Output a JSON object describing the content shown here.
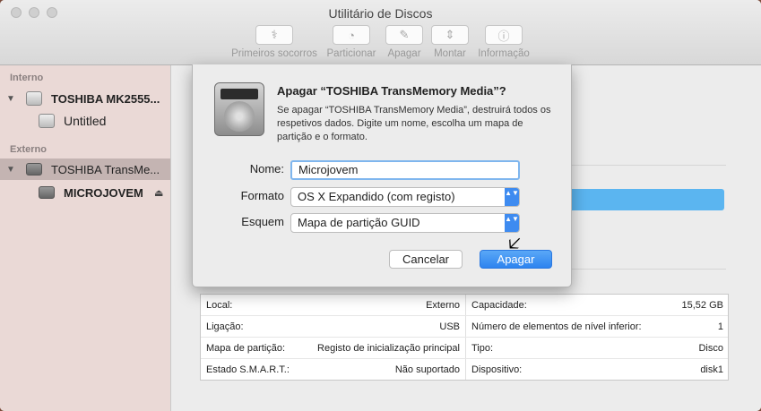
{
  "window": {
    "title": "Utilitário de Discos"
  },
  "toolbar": [
    {
      "label": "Primeiros socorros",
      "icon": "stethoscope-icon",
      "glyph": "⚕"
    },
    {
      "label": "Particionar",
      "icon": "pie-icon",
      "glyph": "◔"
    },
    {
      "label": "Apagar",
      "icon": "eraser-icon",
      "glyph": "✎"
    },
    {
      "label": "Montar",
      "icon": "mount-icon",
      "glyph": "⇕"
    },
    {
      "label": "Informação",
      "icon": "info-icon",
      "glyph": "ⓘ"
    }
  ],
  "sidebar": {
    "internal_header": "Interno",
    "external_header": "Externo",
    "internal_disk": "TOSHIBA MK2555...",
    "internal_volume": "Untitled",
    "external_disk": "TOSHIBA TransMe...",
    "external_volume": "MICROJOVEM",
    "triangle": "▼",
    "eject": "⏏"
  },
  "dialog": {
    "title": "Apagar “TOSHIBA TransMemory Media”?",
    "message": "Se apagar “TOSHIBA TransMemory Media”, destruirá todos os respetivos dados. Digite um nome, escolha um mapa de partição e o formato.",
    "name_label": "Nome:",
    "name_value": "Microjovem",
    "format_label": "Formato",
    "format_value": "OS X Expandido (com registo)",
    "scheme_label": "Esquem",
    "scheme_value": "Mapa de partição GUID",
    "cancel": "Cancelar",
    "confirm": "Apagar",
    "popup_arrows": "▲▼"
  },
  "info": {
    "left": [
      {
        "label": "Local:",
        "value": "Externo"
      },
      {
        "label": "Ligação:",
        "value": "USB"
      },
      {
        "label": "Mapa de partição:",
        "value": "Registo de inicialização principal"
      },
      {
        "label": "Estado S.M.A.R.T.:",
        "value": "Não suportado"
      }
    ],
    "right": [
      {
        "label": "Capacidade:",
        "value": "15,52 GB"
      },
      {
        "label": "Número de elementos de nível inferior:",
        "value": "1"
      },
      {
        "label": "Tipo:",
        "value": "Disco"
      },
      {
        "label": "Dispositivo:",
        "value": "disk1"
      }
    ]
  },
  "colors": {
    "accent": "#3e8bf0",
    "sidebar_bg": "#ead9d6",
    "selection": "#c4b4b2",
    "usage_bar": "#5bb5f0"
  }
}
